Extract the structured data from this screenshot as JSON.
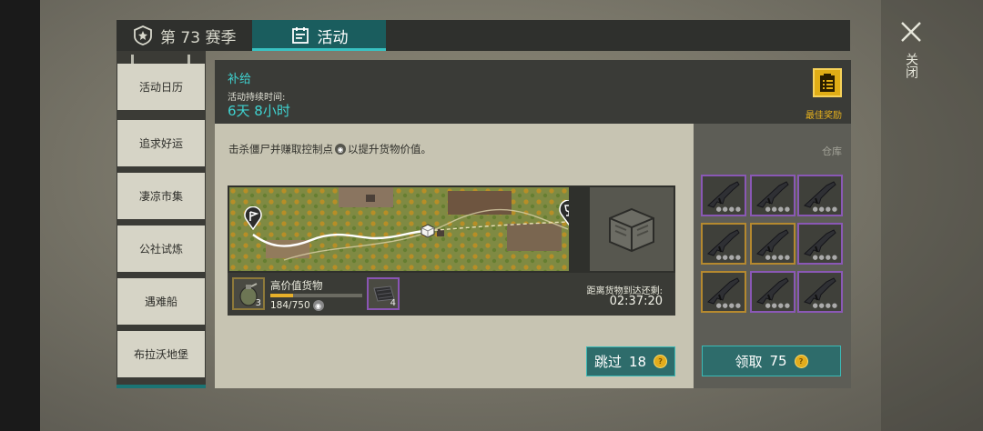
{
  "tabs": {
    "season": "第 73 赛季",
    "activity": "活动"
  },
  "menu": [
    "活动日历",
    "追求好运",
    "凄凉市集",
    "公社试炼",
    "遇难船",
    "布拉沃地堡"
  ],
  "header": {
    "title": "补给",
    "duration_label": "活动持续时间:",
    "duration_value": "6天 8小时",
    "best_reward_label": "最佳奖励"
  },
  "main": {
    "description_pre": "击杀僵尸并赚取控制点",
    "description_post": "以提升货物价值。",
    "cargo_name": "高价值货物",
    "cargo_progress": "184/750",
    "cargo_fraction": 0.245,
    "slot1_count": "3",
    "slot2_count": "4",
    "eta_label": "距离货物到达还剩:",
    "eta_time": "02:37:20"
  },
  "skip": {
    "label": "跳过",
    "cost": "18"
  },
  "warehouse": {
    "label": "仓库"
  },
  "claim": {
    "label": "领取",
    "cost": "75"
  },
  "close_label": "关闭",
  "colors": {
    "accent_teal": "#3fd2d0",
    "gold": "#e3ac1c",
    "epic_purple": "#8a58b5",
    "legendary_orange": "#b5892f"
  }
}
